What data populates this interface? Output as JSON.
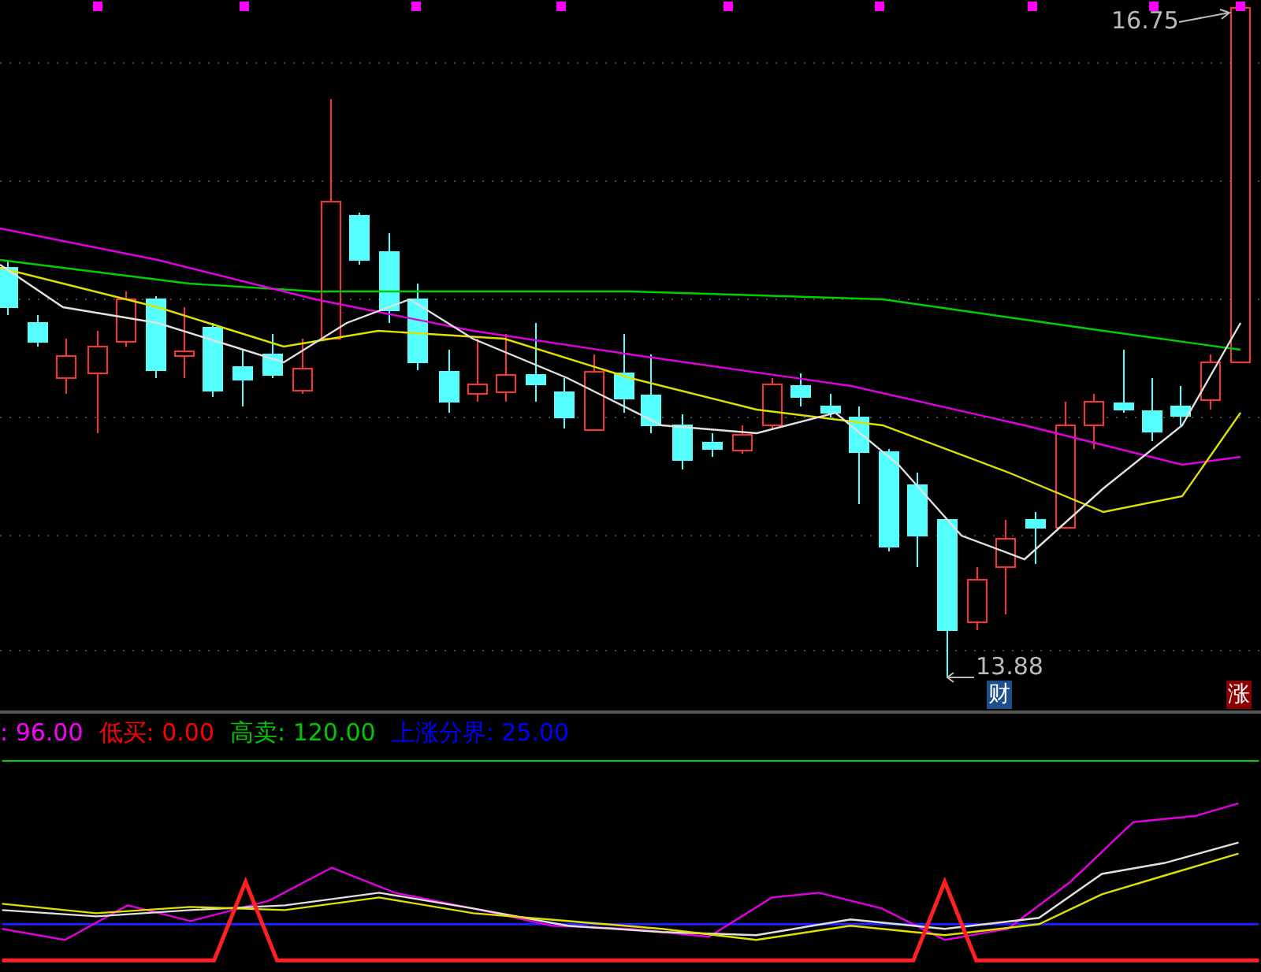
{
  "price_chart": {
    "high_label": "16.75",
    "low_label": "13.88",
    "badges": [
      {
        "kind": "finance",
        "text": "财"
      },
      {
        "kind": "rise",
        "text": "涨"
      }
    ]
  },
  "indicator_legend": [
    {
      "text": ": 96.00",
      "color": "#ff00ff"
    },
    {
      "text": "低买: 0.00",
      "color": "#ff0000"
    },
    {
      "text": "高卖: 120.00",
      "color": "#00c800"
    },
    {
      "text": "上涨分界: 25.00",
      "color": "#0000ff"
    }
  ]
}
